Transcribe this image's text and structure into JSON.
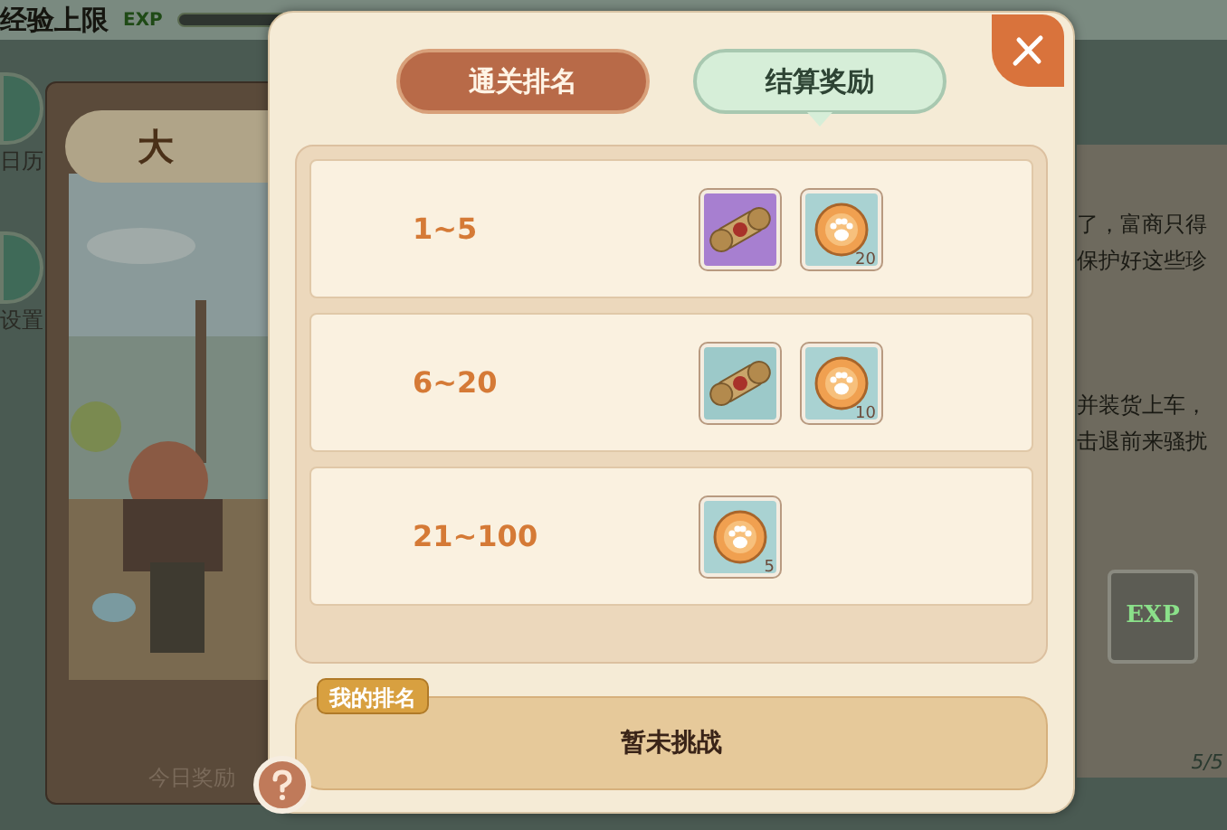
{
  "background": {
    "exp_label": "经验上限",
    "exp_badge": "EXP",
    "side_buttons": [
      {
        "label": "日历"
      },
      {
        "label": "设置"
      }
    ],
    "board_title": "大",
    "board_caption": "今日奖励",
    "story_lines": [
      "了，富商只得",
      "保护好这些珍"
    ],
    "story_lines_2": [
      "并装货上车，",
      "击退前来骚扰"
    ],
    "exp_item": "EXP",
    "counter": "5/5"
  },
  "tabs": [
    {
      "label": "通关排名",
      "selected": false
    },
    {
      "label": "结算奖励",
      "selected": true
    }
  ],
  "ranks": [
    {
      "range": "1~5",
      "rewards": [
        {
          "kind": "scroll",
          "color": "#a77fd0"
        },
        {
          "kind": "coin",
          "count": "20"
        }
      ]
    },
    {
      "range": "6~20",
      "rewards": [
        {
          "kind": "scroll",
          "color": "#9cc9c9"
        },
        {
          "kind": "coin",
          "count": "10"
        }
      ]
    },
    {
      "range": "21~100",
      "rewards": [
        {
          "kind": "coin",
          "count": "5"
        }
      ]
    }
  ],
  "my_rank": {
    "tag": "我的排名",
    "value": "暂未挑战"
  }
}
